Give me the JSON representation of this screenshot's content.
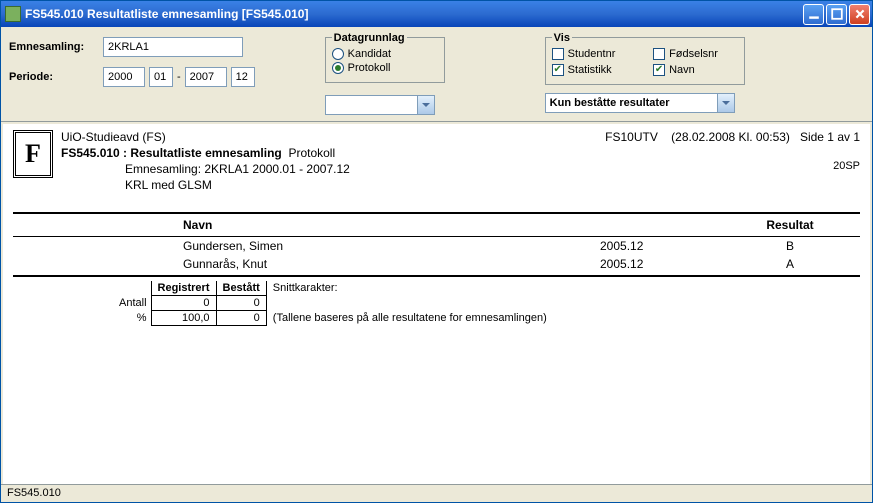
{
  "window": {
    "title": "FS545.010 Resultatliste emnesamling [FS545.010]"
  },
  "form": {
    "emnesamling_label": "Emnesamling:",
    "emnesamling_value": "2KRLA1",
    "periode_label": "Periode:",
    "year_from": "2000",
    "month_from": "01",
    "year_to": "2007",
    "month_to": "12"
  },
  "datagrunnlag": {
    "legend": "Datagrunnlag",
    "kandidat": "Kandidat",
    "protokoll": "Protokoll",
    "selected": "protokoll"
  },
  "vis": {
    "legend": "Vis",
    "studentnr": "Studentnr",
    "studentnr_checked": false,
    "fodselsnr": "Fødselsnr",
    "fodselsnr_checked": false,
    "statistikk": "Statistikk",
    "statistikk_checked": true,
    "navn": "Navn",
    "navn_checked": true
  },
  "combo_sort": "",
  "combo_filter": "Kun beståtte resultater",
  "report": {
    "org": "UiO-Studieavd (FS)",
    "sys": "FS10UTV",
    "timestamp": "(28.02.2008 Kl. 00:53)",
    "page": "Side 1 av 1",
    "code_title": "FS545.010 : Resultatliste emnesamling",
    "mode": "Protokoll",
    "line3": "Emnesamling: 2KRLA1 2000.01 - 2007.12",
    "sp": "20SP",
    "line4": "KRL med GLSM",
    "col_navn": "Navn",
    "col_resultat": "Resultat",
    "rows": [
      {
        "navn": "Gundersen, Simen",
        "dato": "2005.12",
        "kar": "B"
      },
      {
        "navn": "Gunnarås, Knut",
        "dato": "2005.12",
        "kar": "A"
      }
    ],
    "stats_hdr_reg": "Registrert",
    "stats_hdr_best": "Bestått",
    "stats_hdr_snitt": "Snittkarakter:",
    "stats_antall_label": "Antall",
    "stats_antall_reg": "0",
    "stats_antall_best": "0",
    "stats_pct_label": "%",
    "stats_pct_reg": "100,0",
    "stats_pct_best": "0",
    "stats_note": "(Tallene baseres på alle resultatene for emnesamlingen)"
  },
  "status": "FS545.010"
}
